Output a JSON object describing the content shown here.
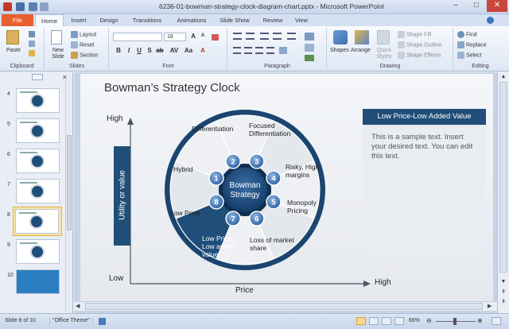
{
  "window": {
    "title": "6236-01-bowman-strategy-clock-diagram-chart.pptx - Microsoft PowerPoint"
  },
  "tabs": [
    "File",
    "Home",
    "Insert",
    "Design",
    "Transitions",
    "Animations",
    "Slide Show",
    "Review",
    "View"
  ],
  "ribbon": {
    "clipboard": {
      "label": "Clipboard",
      "paste": "Paste"
    },
    "slides": {
      "label": "Slides",
      "new_slide": "New Slide",
      "layout": "Layout",
      "reset": "Reset",
      "section": "Section"
    },
    "font": {
      "label": "Font",
      "size": "18"
    },
    "paragraph": {
      "label": "Paragraph"
    },
    "drawing": {
      "label": "Drawing",
      "shapes": "Shapes",
      "arrange": "Arrange",
      "quick_styles": "Quick Styles",
      "shape_fill": "Shape Fill",
      "shape_outline": "Shape Outline",
      "shape_effects": "Shape Effects"
    },
    "editing": {
      "label": "Editing",
      "find": "Find",
      "replace": "Replace",
      "select": "Select"
    }
  },
  "thumbnails": {
    "numbers": [
      "4",
      "5",
      "6",
      "7",
      "8",
      "9",
      "10"
    ],
    "selected": "8"
  },
  "slide": {
    "title": "Bowman’s Strategy Clock",
    "y_high": "High",
    "y_low": "Low",
    "y_axis": "Utility or value",
    "x_axis": "Price",
    "x_high": "High",
    "center": "Bowman Strategy",
    "segments": {
      "differentiation": "Differentiation",
      "focused": "Focused Differentiation",
      "risky": "Risky, High margins",
      "monopoly": "Monopoly Pricing",
      "loss": "Loss of market share",
      "lowprice_value": "Low Price / Low added value",
      "lowprice": "Low Price",
      "hybrid": "Hybrid"
    },
    "badges": [
      "1",
      "2",
      "3",
      "4",
      "5",
      "6",
      "7",
      "8"
    ],
    "box_title": "Low Price-Low Added Value",
    "box_text": "This is a sample text. Insert your desired text. You can edit this text."
  },
  "status": {
    "slide": "Slide 8 of 10",
    "theme": "\"Office Theme\"",
    "zoom": "66%"
  },
  "colors": {
    "navy": "#1f4e79",
    "accent": "#2f5f95",
    "file_tab": "#e8612c"
  }
}
